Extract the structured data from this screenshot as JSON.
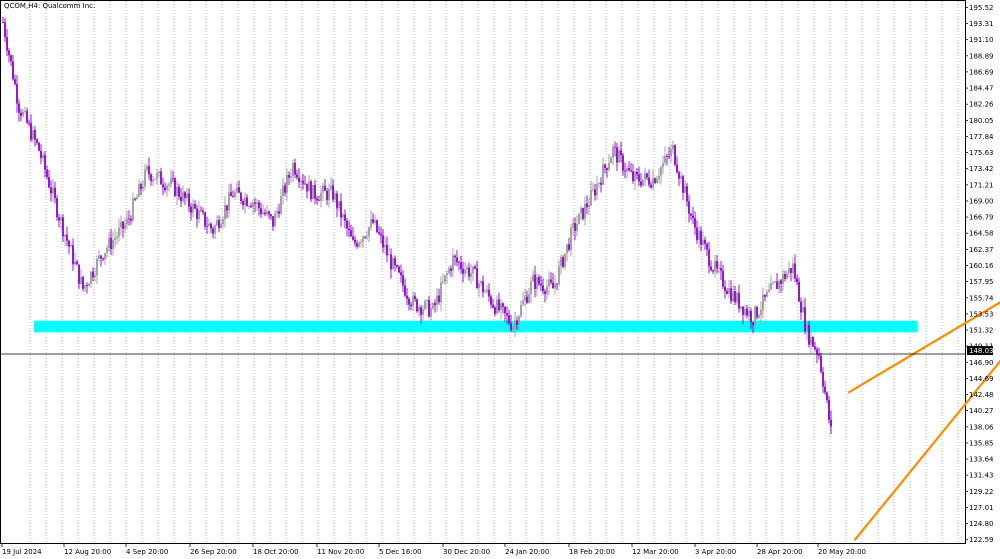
{
  "window": {
    "symbol_title": "QCOM,H4:  Qualcomm Inc."
  },
  "price_tag": {
    "label": "148.03",
    "value": 148.03
  },
  "colors": {
    "background": "#ffffff",
    "bull_candle": "#9b9b9b",
    "bear_candle": "#8b00c9",
    "support_zone": "#00ffff",
    "trend_lines": "#ff8c00",
    "highlight_box": "#b44bd6",
    "grid": "#808080",
    "price_line": "#000000"
  },
  "chart_data": {
    "type": "candlestick",
    "title": "QCOM,H4:  Qualcomm Inc.",
    "ylim": [
      122.0,
      196.4
    ],
    "y_ticks": [
      "195.52",
      "193.31",
      "191.10",
      "188.89",
      "186.69",
      "184.47",
      "182.26",
      "180.05",
      "177.84",
      "175.63",
      "173.42",
      "171.21",
      "169.00",
      "166.79",
      "164.58",
      "162.37",
      "160.16",
      "157.95",
      "155.74",
      "153.53",
      "151.32",
      "149.11",
      "146.90",
      "144.69",
      "142.48",
      "140.27",
      "138.06",
      "135.85",
      "133.64",
      "131.43",
      "129.22",
      "127.01",
      "124.80",
      "122.59"
    ],
    "x_ticks": [
      "19 Jul 2024",
      "12 Aug 20:00",
      "4 Sep 20:00",
      "26 Sep 20:00",
      "18 Oct 20:00",
      "11 Nov 20:00",
      "5 Dec 16:00",
      "30 Dec 20:00",
      "24 Jan 20:00",
      "18 Feb 20:00",
      "12 Mar 20:00",
      "3 Apr 20:00",
      "28 Apr 20:00",
      "20 May 20:00"
    ],
    "bar_count": 415,
    "price_path": [
      [
        0,
        193.5
      ],
      [
        8,
        182
      ],
      [
        18,
        176
      ],
      [
        28,
        167
      ],
      [
        40,
        157
      ],
      [
        50,
        162
      ],
      [
        62,
        166
      ],
      [
        72,
        173
      ],
      [
        85,
        171
      ],
      [
        95,
        168
      ],
      [
        105,
        165
      ],
      [
        115,
        170
      ],
      [
        125,
        169
      ],
      [
        135,
        166
      ],
      [
        145,
        174
      ],
      [
        155,
        170
      ],
      [
        165,
        170
      ],
      [
        175,
        163
      ],
      [
        185,
        166
      ],
      [
        195,
        160
      ],
      [
        205,
        155
      ],
      [
        215,
        154
      ],
      [
        225,
        161
      ],
      [
        235,
        159
      ],
      [
        245,
        155
      ],
      [
        255,
        152
      ],
      [
        265,
        158
      ],
      [
        275,
        157
      ],
      [
        285,
        165
      ],
      [
        295,
        170
      ],
      [
        305,
        176
      ],
      [
        315,
        172
      ],
      [
        325,
        172
      ],
      [
        335,
        176
      ],
      [
        345,
        166
      ],
      [
        355,
        160
      ],
      [
        365,
        156
      ],
      [
        375,
        153
      ],
      [
        385,
        157
      ],
      [
        395,
        160
      ],
      [
        402,
        151
      ],
      [
        408,
        148
      ],
      [
        412,
        141
      ],
      [
        418,
        130
      ],
      [
        422,
        125
      ],
      [
        428,
        136
      ],
      [
        434,
        141
      ],
      [
        440,
        143
      ],
      [
        446,
        147
      ],
      [
        452,
        149
      ],
      [
        456,
        149
      ],
      [
        460,
        140
      ],
      [
        466,
        144
      ],
      [
        470,
        148
      ],
      [
        476,
        147
      ],
      [
        482,
        152
      ],
      [
        490,
        151
      ],
      [
        496,
        154
      ],
      [
        500,
        156
      ],
      [
        503,
        152
      ],
      [
        506,
        146
      ],
      [
        510,
        148
      ]
    ],
    "support_zone": {
      "y_low": 151.0,
      "y_high": 152.6
    },
    "horizontal_line": 148.03,
    "highlight_box": {
      "bar_start": 500,
      "bar_end": 507,
      "y_low": 153.5,
      "y_high": 157.6
    },
    "trend_lines": [
      {
        "bar_start": 423,
        "y_start": 142.8,
        "bar_end": 512,
        "y_end": 157.3
      },
      {
        "bar_start": 426,
        "y_start": 122.6,
        "bar_end": 513,
        "y_end": 151.9
      }
    ]
  }
}
